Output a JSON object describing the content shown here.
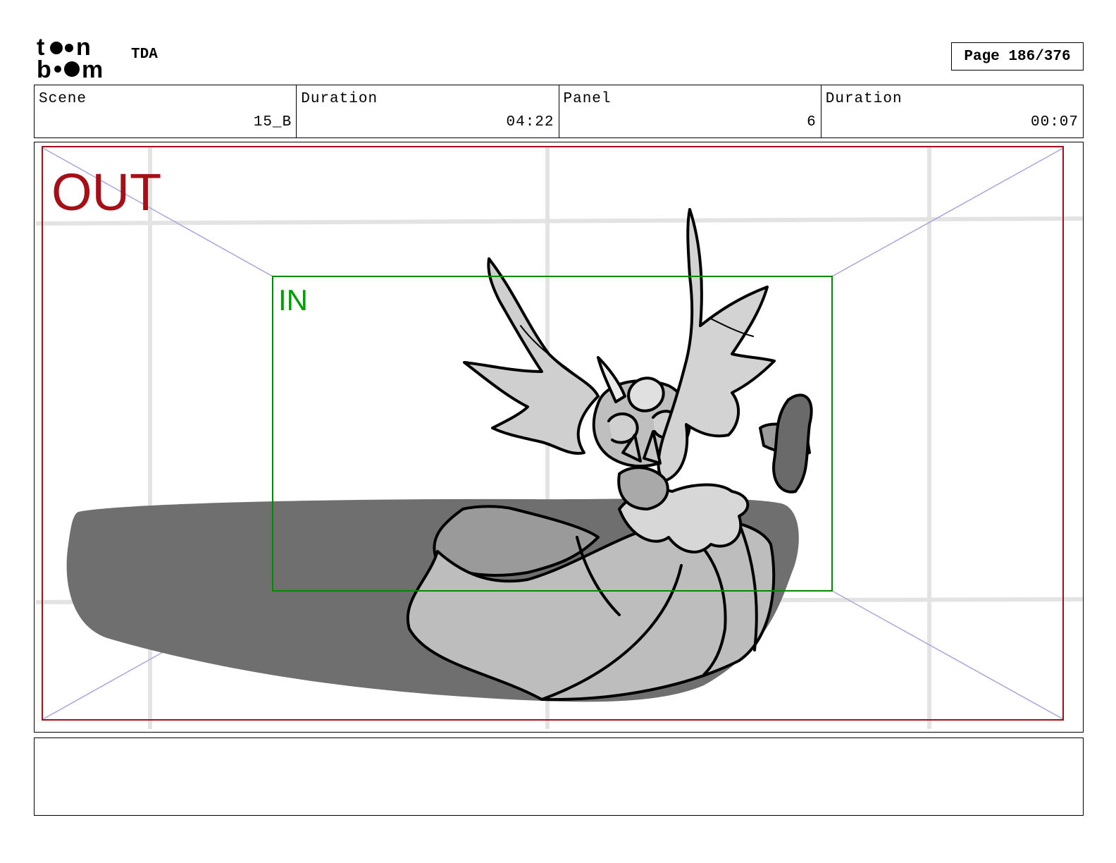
{
  "header": {
    "logo_text": "toon boom",
    "project": "TDA",
    "page": "Page 186/376"
  },
  "info": {
    "scene_label": "Scene",
    "scene_value": "15_B",
    "scene_duration_label": "Duration",
    "scene_duration_value": "04:22",
    "panel_label": "Panel",
    "panel_value": "6",
    "panel_duration_label": "Duration",
    "panel_duration_value": "00:07"
  },
  "frame": {
    "out_label": "OUT",
    "in_label": "IN",
    "out_color": "#a50f15",
    "in_color": "#008a00"
  },
  "notes": {
    "text": ""
  }
}
